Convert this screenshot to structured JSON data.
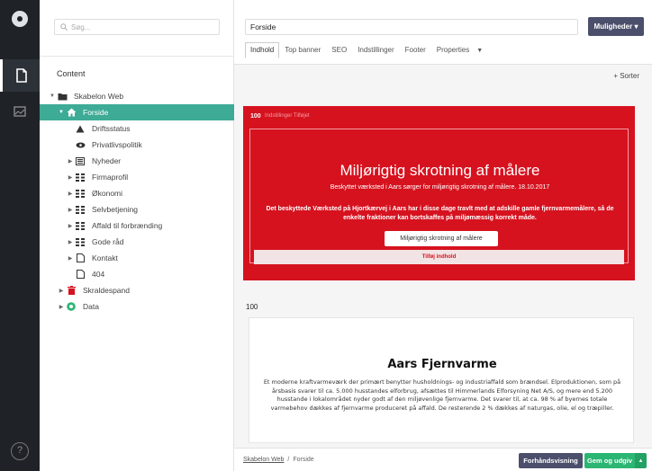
{
  "colors": {
    "rail": "#1f2328",
    "selected": "#3dab96",
    "banner": "#d6121f",
    "actions": "#4b4f6b",
    "publish": "#2bb673"
  },
  "search": {
    "placeholder": "Søg..."
  },
  "tree": {
    "heading": "Content",
    "nodes": [
      {
        "label": "Skabelon Web",
        "icon": "folder-icon"
      },
      {
        "label": "Forside",
        "icon": "home-icon"
      },
      {
        "label": "Driftsstatus",
        "icon": "warning-icon"
      },
      {
        "label": "Privatlivspolitik",
        "icon": "eye-icon"
      },
      {
        "label": "Nyheder",
        "icon": "newspaper-icon"
      },
      {
        "label": "Firmaprofil",
        "icon": "grid-icon"
      },
      {
        "label": "Økonomi",
        "icon": "grid-icon"
      },
      {
        "label": "Selvbetjening",
        "icon": "grid-icon"
      },
      {
        "label": "Affald til forbrænding",
        "icon": "grid-icon"
      },
      {
        "label": "Gode råd",
        "icon": "grid-icon"
      },
      {
        "label": "Kontakt",
        "icon": "document-icon"
      },
      {
        "label": "404",
        "icon": "document-icon"
      },
      {
        "label": "Skraldespand",
        "icon": "trash-icon"
      },
      {
        "label": "Data",
        "icon": "data-icon"
      }
    ]
  },
  "header": {
    "name_value": "Forside",
    "actions_label": "Muligheder ▾",
    "tabs": [
      "Indhold",
      "Top banner",
      "SEO",
      "Indstillinger",
      "Footer",
      "Properties"
    ]
  },
  "content": {
    "sort_label": "+ Sorter",
    "banner": {
      "number": "100",
      "meta": "Indstillinger Tilføjet",
      "title": "Miljørigtig skrotning af målere",
      "subtitle": "Beskyttet værksted i Aars sørger for miljørigtig skrotning af målere. 18.10.2017",
      "text": "Det beskyttede Værksted på Hjortkærvej i Aars har i disse dage travlt med at adskille gamle fjernvarmemålere, så de enkelte fraktioner kan bortskaffes på miljømæssig korrekt måde.",
      "button": "Miljørigtig skrotning af målere",
      "add_label": "Tilføj indhold"
    },
    "block2": {
      "number": "100",
      "title": "Aars Fjernvarme",
      "text": "Et moderne kraftvarmeværk der primært benytter husholdnings- og industriaffald som brændsel. Elproduktionen, som på årsbasis svarer til ca. 5.000 husstandes elforbrug, afsættes til Himmerlands Elforsyning Net A/S, og mere end 5.200 husstande i lokalområdet nyder godt af den miljøvenlige fjernvarme. Det svarer til, at ca. 98 % af byernes totale varmebehov dækkes af fjernvarme produceret på affald. De resterende 2 % dækkes af naturgas, olie, el og træpiller."
    }
  },
  "footer": {
    "breadcrumb_root": "Skabelon Web",
    "breadcrumb_sep": "/",
    "breadcrumb_current": "Forside",
    "preview_label": "Forhåndsvisning",
    "publish_label": "Gem og udgiv",
    "publish_caret": "▲"
  },
  "rail": {
    "help": "?"
  }
}
